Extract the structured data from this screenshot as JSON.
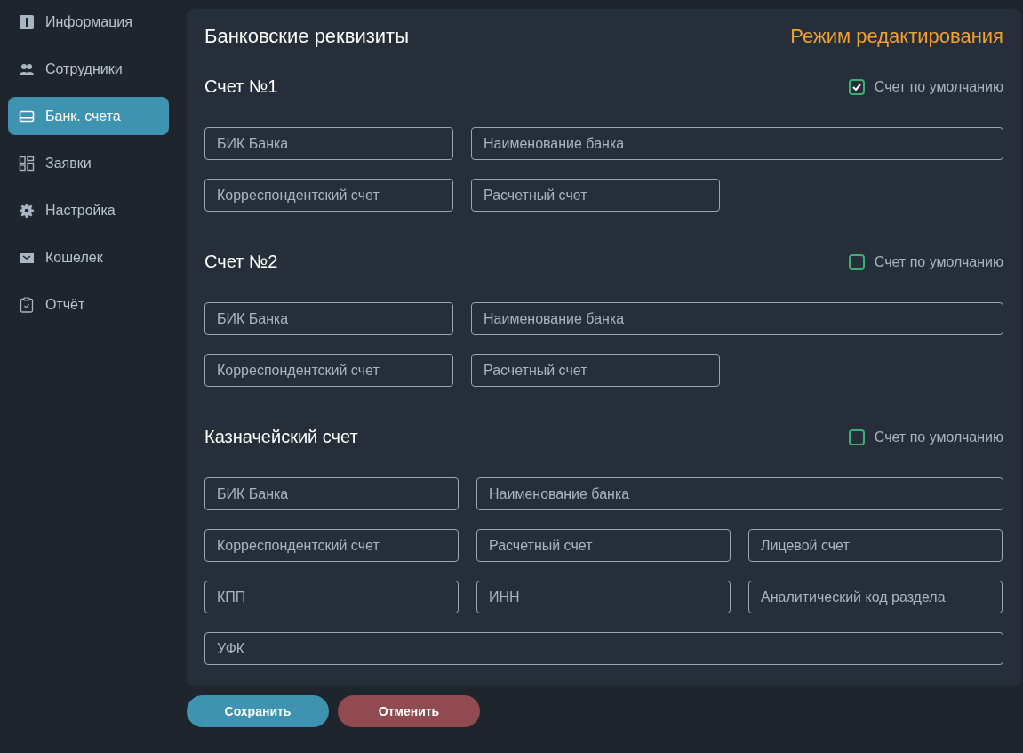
{
  "sidebar": {
    "items": [
      {
        "label": "Информация",
        "kind": "info",
        "selected": false
      },
      {
        "label": "Сотрудники",
        "kind": "users",
        "selected": false
      },
      {
        "label": "Банк. счета",
        "kind": "card",
        "selected": true
      },
      {
        "label": "Заявки",
        "kind": "grid",
        "selected": false
      },
      {
        "label": "Настройка",
        "kind": "gear",
        "selected": false
      },
      {
        "label": "Кошелек",
        "kind": "wallet",
        "selected": false
      },
      {
        "label": "Отчёт",
        "kind": "clipboard",
        "selected": false
      }
    ]
  },
  "panel": {
    "title": "Банковские реквизиты",
    "mode": "Режим редактирования",
    "sections": [
      {
        "kind": "account",
        "title": "Счет №1",
        "default_label": "Счет по умолчанию",
        "checked": true,
        "rows": [
          [
            {
              "placeholder": "БИК Банка"
            },
            {
              "placeholder": "Наименование банка"
            }
          ],
          [
            {
              "placeholder": "Корреспондентский счет"
            },
            {
              "placeholder": "Расчетный счет"
            }
          ]
        ]
      },
      {
        "kind": "account",
        "title": "Счет №2",
        "default_label": "Счет по умолчанию",
        "checked": false,
        "rows": [
          [
            {
              "placeholder": "БИК Банка"
            },
            {
              "placeholder": "Наименование банка"
            }
          ],
          [
            {
              "placeholder": "Корреспондентский счет"
            },
            {
              "placeholder": "Расчетный счет"
            }
          ]
        ]
      },
      {
        "kind": "treasury",
        "title": "Казначейский счет",
        "default_label": "Счет по умолчанию",
        "checked": false,
        "rows": [
          [
            {
              "placeholder": "БИК Банка"
            },
            {
              "placeholder": "Наименование банка"
            }
          ],
          [
            {
              "placeholder": "Корреспондентский счет"
            },
            {
              "placeholder": "Расчетный счет"
            },
            {
              "placeholder": "Лицевой счет"
            }
          ],
          [
            {
              "placeholder": "КПП"
            },
            {
              "placeholder": "ИНН"
            },
            {
              "placeholder": "Аналитический код раздела"
            }
          ],
          [
            {
              "placeholder": "УФК"
            }
          ]
        ]
      }
    ]
  },
  "buttons": [
    {
      "kind": "save",
      "label": "Сохранить"
    },
    {
      "kind": "cancel",
      "label": "Отменить"
    }
  ]
}
